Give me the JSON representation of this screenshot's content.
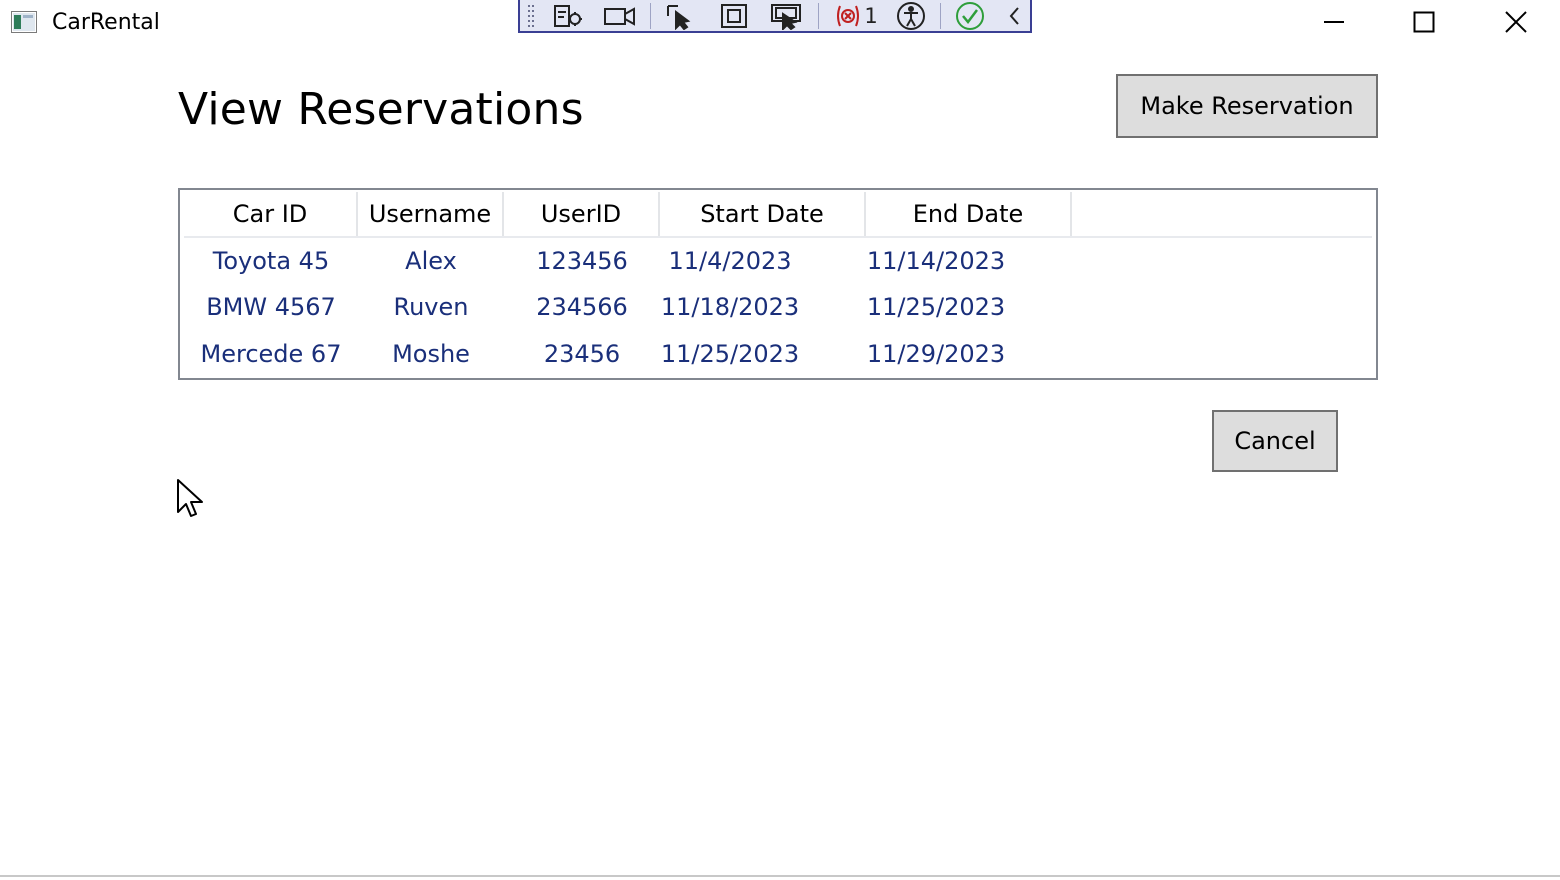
{
  "window": {
    "title": "CarRental"
  },
  "debug_toolbar": {
    "binding_failures_count": "1",
    "icons": [
      "grip-icon",
      "visual-tree-icon",
      "camera-icon",
      "select-element-icon",
      "adorner-icon",
      "track-focus-icon",
      "binding-failures-icon",
      "accessibility-icon",
      "checkmark-icon",
      "collapse-chevron-icon"
    ]
  },
  "main": {
    "page_title": "View Reservations",
    "make_reservation_label": "Make Reservation",
    "cancel_label": "Cancel"
  },
  "grid": {
    "columns": [
      "Car ID",
      "Username",
      "UserID",
      "Start Date",
      "End Date"
    ],
    "rows": [
      [
        "Toyota 45",
        "Alex",
        "123456",
        "11/4/2023",
        "11/14/2023"
      ],
      [
        "BMW 4567",
        "Ruven",
        "234566",
        "11/18/2023",
        "11/25/2023"
      ],
      [
        "Mercede 67",
        "Moshe",
        "23456",
        "11/25/2023",
        "11/29/2023"
      ]
    ]
  },
  "colors": {
    "cell_text": "#1a2f7a",
    "toolbar_bg": "#e3e6f4",
    "toolbar_border": "#3a3f94",
    "button_bg": "#dddddd"
  }
}
